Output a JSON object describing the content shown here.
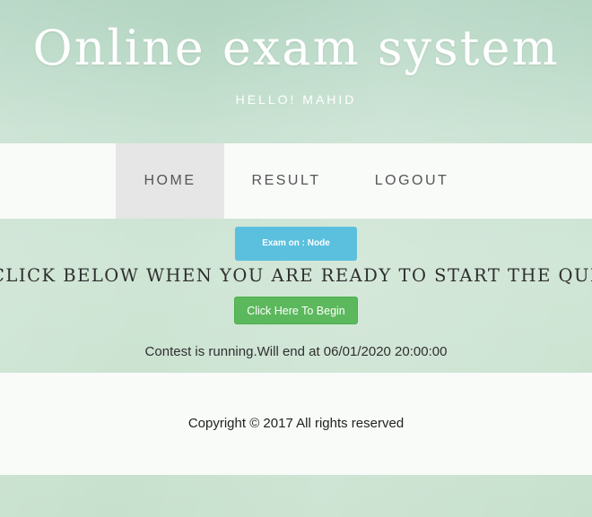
{
  "header": {
    "title": "Online exam system",
    "greeting": "HELLO! MAHID"
  },
  "nav": {
    "items": [
      {
        "label": "HOME",
        "active": true
      },
      {
        "label": "RESULT",
        "active": false
      },
      {
        "label": "LOGOUT",
        "active": false
      }
    ]
  },
  "main": {
    "exam_badge": "Exam on : Node",
    "ready_text": "CLICK BELOW WHEN YOU ARE READY TO START THE QUIZ",
    "begin_button": "Click Here To Begin",
    "contest_status": "Contest is running.Will end at 06/01/2020 20:00:00"
  },
  "footer": {
    "copyright": "Copyright © 2017 All rights reserved"
  },
  "colors": {
    "info_badge": "#5bc0de",
    "success_button": "#5cb85c",
    "nav_active": "#e6e6e6",
    "background": "#cfe5d5"
  }
}
